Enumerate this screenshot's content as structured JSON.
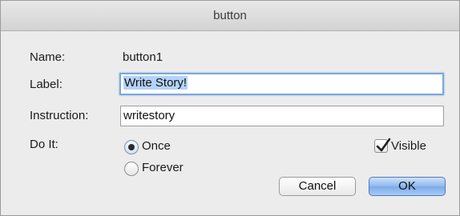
{
  "window": {
    "title": "button"
  },
  "form": {
    "name_label": "Name:",
    "name_value": "button1",
    "label_label": "Label:",
    "label_value": "Write Story!",
    "instruction_label": "Instruction:",
    "instruction_value": "writestory",
    "doit_label": "Do It:",
    "doit_options": [
      {
        "label": "Once",
        "selected": true
      },
      {
        "label": "Forever",
        "selected": false
      }
    ],
    "visible_label": "Visible",
    "visible_checked": true
  },
  "buttons": {
    "cancel_label": "Cancel",
    "ok_label": "OK"
  },
  "colors": {
    "selection": "#b3d3f9",
    "focus_ring": "#7aa7e0",
    "default_button": "#8db8ef"
  }
}
